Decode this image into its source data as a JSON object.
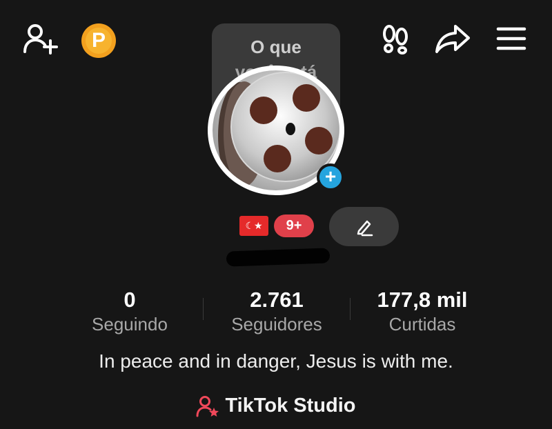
{
  "header": {
    "add_friend_icon": "person-plus-icon",
    "premium_badge_letter": "P",
    "footprints_icon": "footprints-icon",
    "share_icon": "share-arrow-icon",
    "menu_icon": "hamburger-menu-icon"
  },
  "tooltip": {
    "line1": "O que",
    "line2": "você está"
  },
  "profile": {
    "avatar_icon": "film-reel-icon",
    "add_story_symbol": "+",
    "flag": "☾★",
    "badge_count": "9+",
    "edit_icon": "pencil-icon"
  },
  "stats": [
    {
      "value": "0",
      "label": "Seguindo"
    },
    {
      "value": "2.761",
      "label": "Seguidores"
    },
    {
      "value": "177,8 mil",
      "label": "Curtidas"
    }
  ],
  "bio": "In peace and in danger, Jesus is with me.",
  "studio": {
    "label": "TikTok Studio",
    "icon": "person-star-icon"
  },
  "colors": {
    "background": "#161616",
    "accent_red": "#e0404a",
    "blue_badge": "#25a4de",
    "gold_badge": "#f2a01e"
  }
}
